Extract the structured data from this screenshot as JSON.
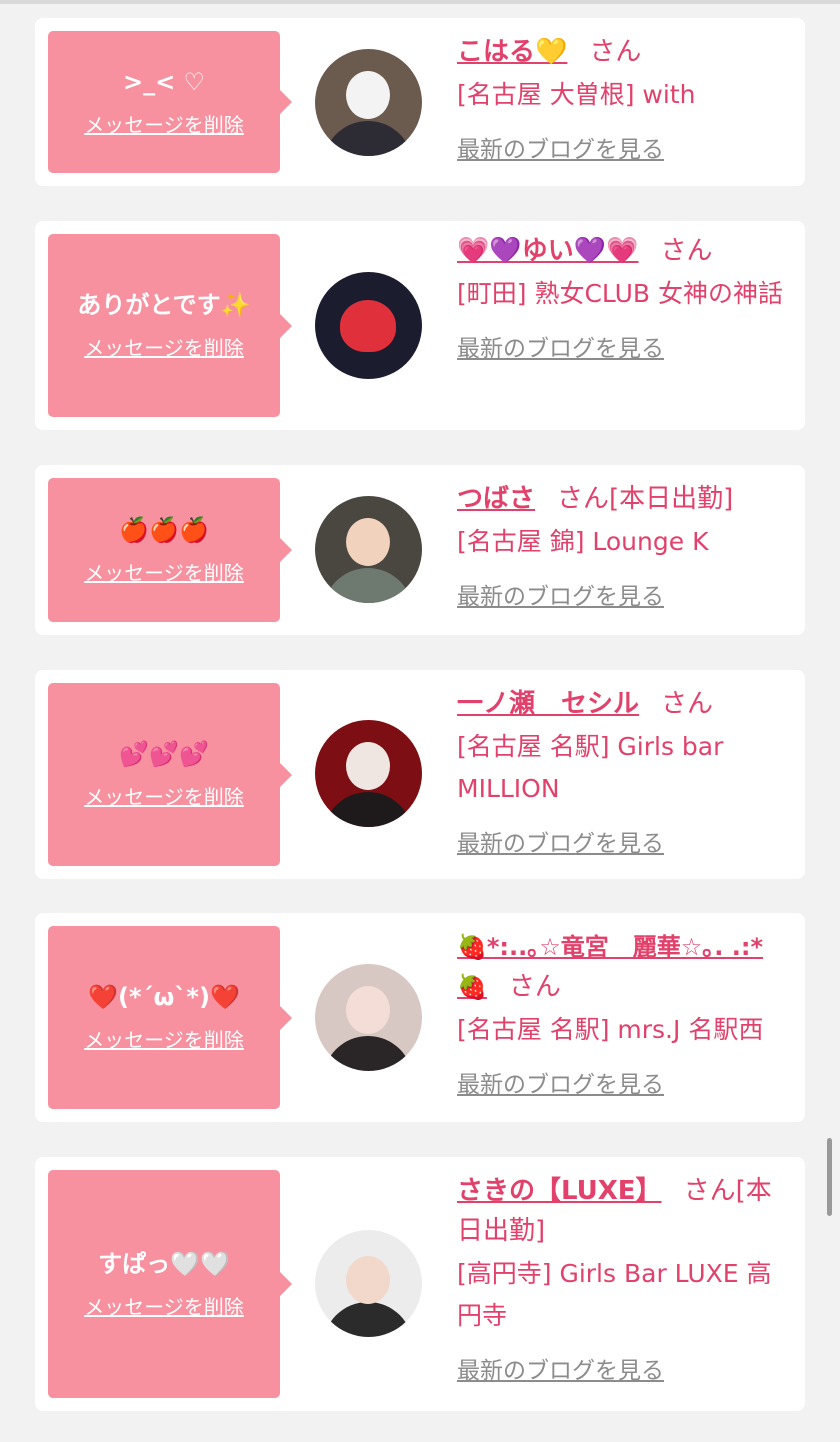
{
  "delete_label": "メッセージを削除",
  "san_label": "さん",
  "blog_label": "最新のブログを見る",
  "cards": [
    {
      "message": ">_< ♡",
      "name": "こはる💛",
      "suffix": "",
      "shop": "[名古屋 大曽根] with"
    },
    {
      "message": "ありがとです✨",
      "name": "💗💜ゆい💜💗",
      "suffix": "",
      "shop": "[町田] 熟女CLUB 女神の神話"
    },
    {
      "message": "🍎🍎🍎",
      "name": "つばさ",
      "suffix": "[本日出勤]",
      "shop": "[名古屋 錦] Lounge K"
    },
    {
      "message": "💕💕💕",
      "name": "一ノ瀬　セシル",
      "suffix": "",
      "shop": "[名古屋 名駅] Girls bar MILLION"
    },
    {
      "message": "❤️(*´ω`*)❤️",
      "name": "🍓*:..｡☆竜宮　麗華☆｡. .:*🍓",
      "suffix": "",
      "shop": "[名古屋 名駅] mrs.J 名駅西"
    },
    {
      "message": "すぱっ🤍🤍",
      "name": "さきの【LUXE】",
      "suffix": "[本日出勤]",
      "shop": "[高円寺] Girls Bar LUXE 高円寺"
    }
  ],
  "colors": {
    "bubble": "#f7909f",
    "accent": "#e2416b",
    "link_gray": "#8c8c8c",
    "background": "#f2f2f2"
  }
}
